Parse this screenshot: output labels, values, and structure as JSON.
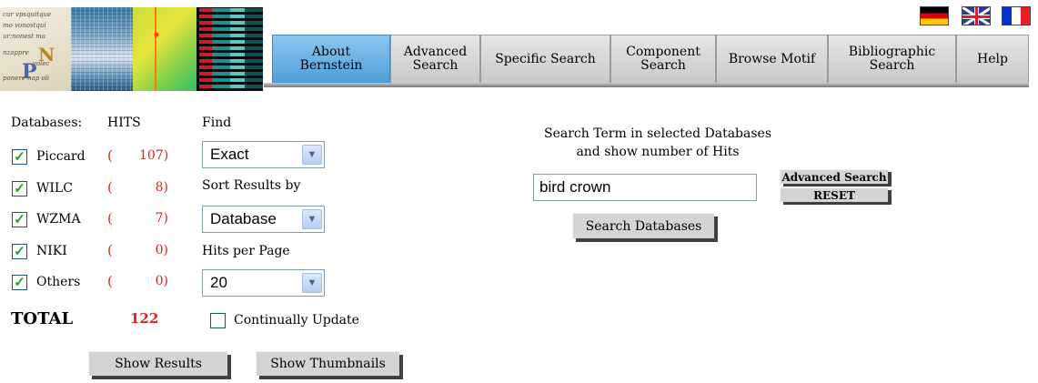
{
  "banner": {
    "manuscript_lines": [
      "cur vpsquitque",
      "mo vonostqui",
      "ur:nonest ma",
      "nzappre",
      "volec",
      "ponere nap oli"
    ],
    "cap_n": "N",
    "cap_p": "P"
  },
  "flags": [
    {
      "name": "German",
      "code": "de"
    },
    {
      "name": "English",
      "code": "en"
    },
    {
      "name": "French",
      "code": "fr"
    }
  ],
  "nav": {
    "tabs": [
      {
        "label": "About Bernstein",
        "active": true
      },
      {
        "label": "Advanced Search",
        "active": false
      },
      {
        "label": "Specific Search",
        "active": false
      },
      {
        "label": "Component Search",
        "active": false
      },
      {
        "label": "Browse Motif",
        "active": false
      },
      {
        "label": "Bibliographic Search",
        "active": false
      },
      {
        "label": "Help",
        "active": false
      }
    ]
  },
  "databases": {
    "header_label": "Databases:",
    "hits_header": "HITS",
    "items": [
      {
        "name": "Piccard",
        "checked": true,
        "paren": "(",
        "hits": "107)"
      },
      {
        "name": "WILC",
        "checked": true,
        "paren": "(",
        "hits": "8)"
      },
      {
        "name": "WZMA",
        "checked": true,
        "paren": "(",
        "hits": "7)"
      },
      {
        "name": "NIKI",
        "checked": true,
        "paren": "(",
        "hits": "0)"
      },
      {
        "name": "Others",
        "checked": true,
        "paren": "(",
        "hits": "0)"
      }
    ],
    "total_label": "TOTAL",
    "total_value": "122"
  },
  "find": {
    "label": "Find",
    "value": "Exact",
    "sort_label": "Sort Results by",
    "sort_value": "Database",
    "hpp_label": "Hits per Page",
    "hpp_value": "20",
    "continually_update_label": "Continually Update",
    "continually_update_checked": false
  },
  "search": {
    "heading_line1": "Search Term in selected Databases",
    "heading_line2": "and show number of Hits",
    "term": "bird crown",
    "search_button": "Search Databases",
    "advanced_button": "Advanced Search",
    "reset_button": "RESET"
  },
  "actions": {
    "show_results": "Show Results",
    "show_thumbnails": "Show Thumbnails"
  },
  "colors": {
    "active_tab": "#5aa6de",
    "hits_red": "#e02020",
    "check_green": "#21a121"
  }
}
